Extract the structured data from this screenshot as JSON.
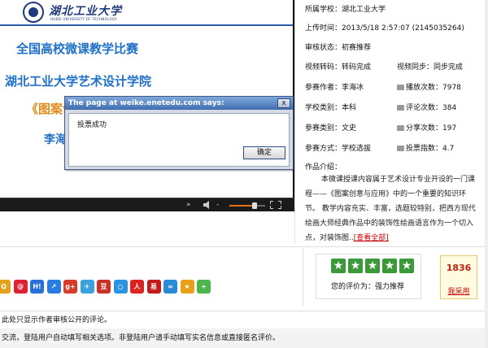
{
  "slide": {
    "logo_text": "湖北工业大学",
    "logo_sub": "HUBEI UNIVERSITY OF TECHNOLOGY",
    "title_line1": "全国高校微课教学比赛",
    "title_line2": "湖北工业大学艺术设计学院",
    "title_line3": "《图案创",
    "title_line4": "李海"
  },
  "player": {
    "next_glyph": "»",
    "volume_level": 0.7
  },
  "dialog": {
    "title": "The page at weike.enetedu.com says:",
    "close_glyph": "x",
    "message": "投票成功",
    "ok_label": "确定"
  },
  "info": {
    "school": "所属学校：湖北工业大学",
    "upload_time": "上传时间：2013/5/18 2:57:07 (2145035264)",
    "review_status": "审核状态：初赛推荐",
    "transcode": "视频转码：转码完成",
    "sync": "视频同步：同步完成",
    "author": "参赛作者：李海冰",
    "plays": "播放次数：7978",
    "school_category": "学校类别：本科",
    "comments": "评论次数：384",
    "entry_category": "参赛类别：文史",
    "shares": "分享次数：197",
    "method": "参赛方式：学校选拔",
    "vote_index": "投票指数：4.7",
    "intro_label": "作品介绍："
  },
  "description": {
    "text": "本微课授课内容属于艺术设计专业开设的一门课程——《图案创意与应用》中的一个重要的知识环节。 教学内容充实、丰富，选题较特别，把西方现代绘画大师经典作品中的装饰性绘画语言作为一个切入点，对装饰图..",
    "more_link": "[查看全部]"
  },
  "share_icons": [
    {
      "name": "qzone-share-icon",
      "color": "#e3a21a",
      "glyph": "Q"
    },
    {
      "name": "renren-share-icon",
      "color": "#d23",
      "glyph": "@"
    },
    {
      "name": "hi-share-icon",
      "color": "#2a6ed8",
      "glyph": "H!"
    },
    {
      "name": "kaixin-share-icon",
      "color": "#2a7de0",
      "glyph": "↗"
    },
    {
      "name": "googleplus-share-icon",
      "color": "#d63b2b",
      "glyph": "g+"
    },
    {
      "name": "twitter-share-icon",
      "color": "#3aa3d9",
      "glyph": "✈"
    },
    {
      "name": "douban-share-icon",
      "color": "#c83227",
      "glyph": "豆"
    },
    {
      "name": "sohu-share-icon",
      "color": "#2c93e0",
      "glyph": "○"
    },
    {
      "name": "people-share-icon",
      "color": "#d22",
      "glyph": "人"
    },
    {
      "name": "wangyi-share-icon",
      "color": "#c41a1a",
      "glyph": "易"
    },
    {
      "name": "mop-share-icon",
      "color": "#2a8ad2",
      "glyph": "∞"
    },
    {
      "name": "xinhua-share-icon",
      "color": "#e8a01a",
      "glyph": "★"
    },
    {
      "name": "more-share-icon",
      "color": "#4cb64c",
      "glyph": "+"
    }
  ],
  "rating": {
    "stars": 5,
    "label": "您的评价为：强力推荐"
  },
  "vote": {
    "count": "1836",
    "button": "我采用"
  },
  "footer": {
    "line1": "此处只显示作者审核公开的评论。",
    "line2": "交流，登陆用户自动填写相关选项。非登陆用户请手动填写实名信息或直接匿名评价。"
  },
  "colors": {
    "title_blue": "#1f70c8",
    "title_orange": "#e08a1a",
    "dialog_title": "#3f6db0",
    "star_green": "#3a9a3a",
    "link_red": "#c00"
  }
}
